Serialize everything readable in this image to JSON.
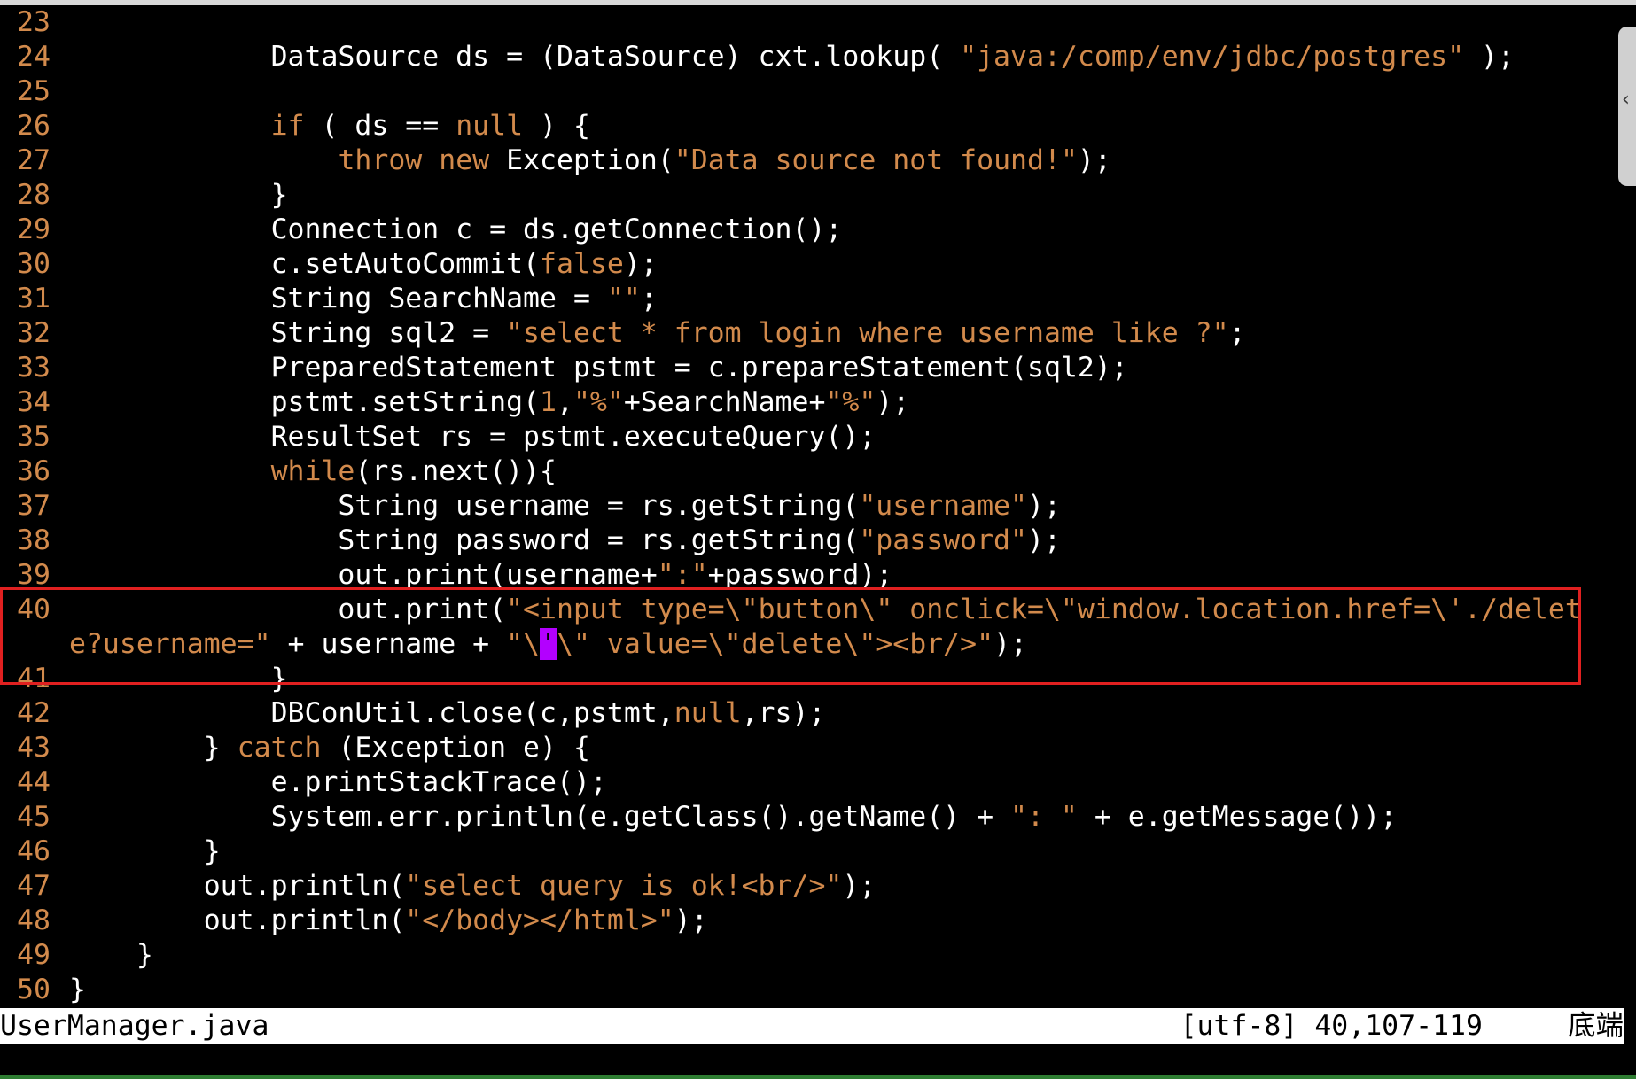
{
  "editor": {
    "lines": [
      {
        "num": "23",
        "segs": []
      },
      {
        "num": "24",
        "segs": [
          {
            "t": "            DataSource ds = (DataSource) cxt.lookup( "
          },
          {
            "t": "\"java:/comp/env/jdbc/postgres\"",
            "c": "str"
          },
          {
            "t": " );"
          }
        ]
      },
      {
        "num": "25",
        "segs": []
      },
      {
        "num": "26",
        "segs": [
          {
            "t": "            "
          },
          {
            "t": "if",
            "c": "kw"
          },
          {
            "t": " ( ds == "
          },
          {
            "t": "null",
            "c": "lit"
          },
          {
            "t": " ) {"
          }
        ]
      },
      {
        "num": "27",
        "segs": [
          {
            "t": "                "
          },
          {
            "t": "throw",
            "c": "kw"
          },
          {
            "t": " "
          },
          {
            "t": "new",
            "c": "kw"
          },
          {
            "t": " Exception("
          },
          {
            "t": "\"Data source not found!\"",
            "c": "str"
          },
          {
            "t": ");"
          }
        ]
      },
      {
        "num": "28",
        "segs": [
          {
            "t": "            }"
          }
        ]
      },
      {
        "num": "29",
        "segs": [
          {
            "t": "            Connection c = ds.getConnection();"
          }
        ]
      },
      {
        "num": "30",
        "segs": [
          {
            "t": "            c.setAutoCommit("
          },
          {
            "t": "false",
            "c": "lit"
          },
          {
            "t": ");"
          }
        ]
      },
      {
        "num": "31",
        "segs": [
          {
            "t": "            String SearchName = "
          },
          {
            "t": "\"\"",
            "c": "str"
          },
          {
            "t": ";"
          }
        ]
      },
      {
        "num": "32",
        "segs": [
          {
            "t": "            String sql2 = "
          },
          {
            "t": "\"select * from login where username like ?\"",
            "c": "str"
          },
          {
            "t": ";"
          }
        ]
      },
      {
        "num": "33",
        "segs": [
          {
            "t": "            PreparedStatement pstmt = c.prepareStatement(sql2);"
          }
        ]
      },
      {
        "num": "34",
        "segs": [
          {
            "t": "            pstmt.setString("
          },
          {
            "t": "1",
            "c": "lit"
          },
          {
            "t": ","
          },
          {
            "t": "\"%\"",
            "c": "str"
          },
          {
            "t": "+SearchName+"
          },
          {
            "t": "\"%\"",
            "c": "str"
          },
          {
            "t": ");"
          }
        ]
      },
      {
        "num": "35",
        "segs": [
          {
            "t": "            ResultSet rs = pstmt.executeQuery();"
          }
        ]
      },
      {
        "num": "36",
        "segs": [
          {
            "t": "            "
          },
          {
            "t": "while",
            "c": "kw"
          },
          {
            "t": "(rs.next()){"
          }
        ]
      },
      {
        "num": "37",
        "segs": [
          {
            "t": "                String username = rs.getString("
          },
          {
            "t": "\"username\"",
            "c": "str"
          },
          {
            "t": ");"
          }
        ]
      },
      {
        "num": "38",
        "segs": [
          {
            "t": "                String password = rs.getString("
          },
          {
            "t": "\"password\"",
            "c": "str"
          },
          {
            "t": ");"
          }
        ]
      },
      {
        "num": "39",
        "segs": [
          {
            "t": "                out.print(username+"
          },
          {
            "t": "\":\"",
            "c": "str"
          },
          {
            "t": "+password);"
          }
        ]
      },
      {
        "num": "40",
        "segs": [
          {
            "t": "                out.print("
          },
          {
            "t": "\"<input type=\\\"button\\\" onclick=\\\"window.location.href=\\'./delet",
            "c": "str"
          }
        ]
      },
      {
        "num": "",
        "wrap": true,
        "segs": [
          {
            "t": "e?username=\"",
            "c": "str"
          },
          {
            "t": " + username + "
          },
          {
            "t": "\"\\",
            "c": "str"
          },
          {
            "t": "'",
            "c": "cursor"
          },
          {
            "t": "\\\" value=\\\"delete\\\"><br/>\"",
            "c": "str"
          },
          {
            "t": ");"
          }
        ]
      },
      {
        "num": "41",
        "segs": [
          {
            "t": "            }"
          }
        ]
      },
      {
        "num": "42",
        "segs": [
          {
            "t": "            DBConUtil.close(c,pstmt,"
          },
          {
            "t": "null",
            "c": "lit"
          },
          {
            "t": ",rs);"
          }
        ]
      },
      {
        "num": "43",
        "segs": [
          {
            "t": "        } "
          },
          {
            "t": "catch",
            "c": "kw"
          },
          {
            "t": " (Exception e) {"
          }
        ]
      },
      {
        "num": "44",
        "segs": [
          {
            "t": "            e.printStackTrace();"
          }
        ]
      },
      {
        "num": "45",
        "segs": [
          {
            "t": "            System.err.println(e.getClass().getName() + "
          },
          {
            "t": "\": \"",
            "c": "str"
          },
          {
            "t": " + e.getMessage());"
          }
        ]
      },
      {
        "num": "46",
        "segs": [
          {
            "t": "        }"
          }
        ]
      },
      {
        "num": "47",
        "segs": [
          {
            "t": "        out.println("
          },
          {
            "t": "\"select query is ok!<br/>\"",
            "c": "str"
          },
          {
            "t": ");"
          }
        ]
      },
      {
        "num": "48",
        "segs": [
          {
            "t": "        out.println("
          },
          {
            "t": "\"</body></html>\"",
            "c": "str"
          },
          {
            "t": ");"
          }
        ]
      },
      {
        "num": "49",
        "segs": [
          {
            "t": "    }"
          }
        ]
      },
      {
        "num": "50",
        "segs": [
          {
            "t": "}"
          }
        ]
      }
    ]
  },
  "statusbar": {
    "filename": "UserManager.java",
    "encoding": "[utf-8]",
    "position": "40,107-119",
    "scroll": "底端"
  },
  "colors": {
    "background": "#000000",
    "keyword": "#d28a4c",
    "line_number": "#d28a4c",
    "highlight_box": "#e02020",
    "cursor": "#b300ff"
  }
}
